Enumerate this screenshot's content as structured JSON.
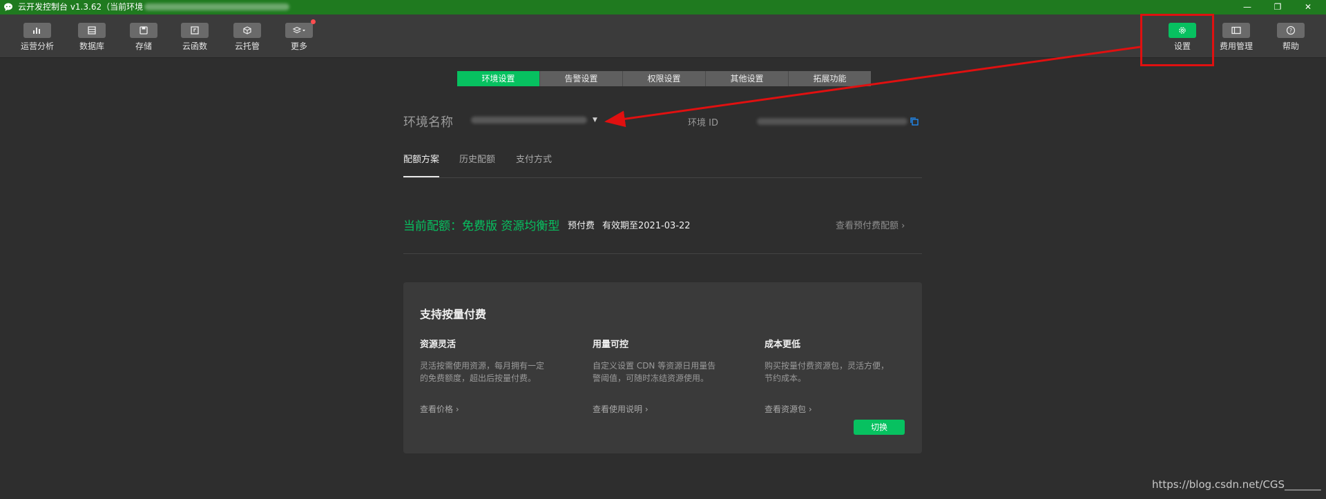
{
  "window": {
    "title": "云开发控制台 v1.3.62（当前环境",
    "controls": {
      "minimize": "—",
      "maximize": "❐",
      "close": "✕"
    }
  },
  "toolbar": {
    "items": [
      {
        "label": "运营分析",
        "icon": "bar-chart-icon"
      },
      {
        "label": "数据库",
        "icon": "database-icon"
      },
      {
        "label": "存储",
        "icon": "storage-icon"
      },
      {
        "label": "云函数",
        "icon": "function-icon"
      },
      {
        "label": "云托管",
        "icon": "container-icon"
      },
      {
        "label": "更多",
        "icon": "layers-icon"
      }
    ],
    "right_items": [
      {
        "label": "设置",
        "icon": "gear-icon"
      },
      {
        "label": "费用管理",
        "icon": "billing-icon"
      },
      {
        "label": "帮助",
        "icon": "help-icon"
      }
    ]
  },
  "settings_tabs": [
    "环境设置",
    "告警设置",
    "权限设置",
    "其他设置",
    "拓展功能"
  ],
  "env": {
    "name_label": "环境名称",
    "id_label": "环境 ID"
  },
  "sub_tabs": [
    "配额方案",
    "历史配额",
    "支付方式"
  ],
  "quota": {
    "current": "当前配额：免费版 资源均衡型",
    "prepay": "预付费",
    "validity": "有效期至2021-03-22",
    "view_prepay": "查看预付费配额 ›"
  },
  "card": {
    "title": "支持按量付费",
    "features": [
      {
        "title": "资源灵活",
        "line1": "灵活按需使用资源，每月拥有一定",
        "line2": "的免费额度，超出后按量付费。",
        "link": "查看价格 ›"
      },
      {
        "title": "用量可控",
        "line1": "自定义设置 CDN 等资源日用量告",
        "line2": "警阈值，可随时冻结资源使用。",
        "link": "查看使用说明 ›"
      },
      {
        "title": "成本更低",
        "line1": "购买按量付费资源包，灵活方便，",
        "line2": "节约成本。",
        "link": "查看资源包 ›"
      }
    ],
    "switch_label": "切换"
  },
  "watermark": "https://blog.csdn.net/CGS_______",
  "colors": {
    "accent": "#07c160",
    "titlebar": "#1f7a1f",
    "annotation": "#e01010"
  }
}
